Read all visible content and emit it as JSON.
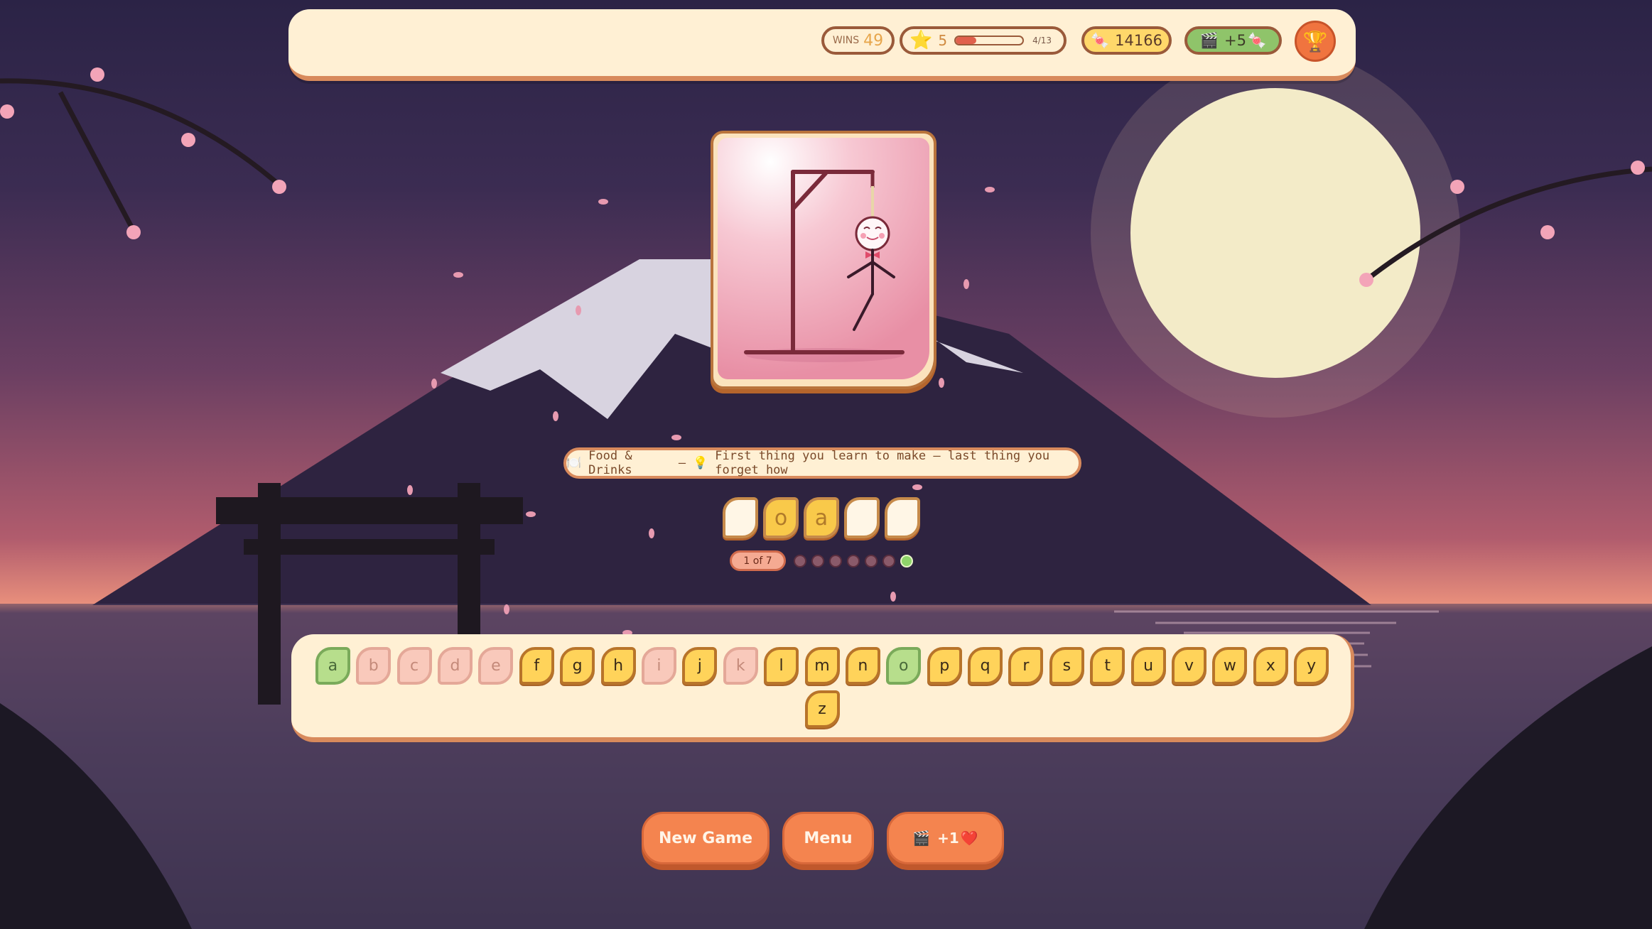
{
  "hud": {
    "wins_label": "WINS",
    "wins_value": "49",
    "level": "5",
    "level_progress": 0.31,
    "level_progress_text": "4/13",
    "candy_count": "14166",
    "bonus_text": "+5",
    "star_icon": "⭐",
    "candy_icon": "🍬",
    "bonus_icon": "🎬",
    "trophy_icon": "🏆"
  },
  "hint": {
    "category_icon": "🍽️",
    "category": "Food & Drinks",
    "separator": "—",
    "bulb_icon": "💡",
    "clue": "First thing you learn to make — last thing you forget how"
  },
  "word": {
    "slots": [
      "",
      "o",
      "a",
      "",
      ""
    ]
  },
  "round": {
    "label": "1 of 7",
    "dots": 7,
    "active_index": 6
  },
  "keyboard": {
    "keys": [
      {
        "letter": "a",
        "state": "correct"
      },
      {
        "letter": "b",
        "state": "wrong"
      },
      {
        "letter": "c",
        "state": "wrong"
      },
      {
        "letter": "d",
        "state": "wrong"
      },
      {
        "letter": "e",
        "state": "wrong"
      },
      {
        "letter": "f",
        "state": "unused"
      },
      {
        "letter": "g",
        "state": "unused"
      },
      {
        "letter": "h",
        "state": "unused"
      },
      {
        "letter": "i",
        "state": "wrong"
      },
      {
        "letter": "j",
        "state": "unused"
      },
      {
        "letter": "k",
        "state": "wrong"
      },
      {
        "letter": "l",
        "state": "unused"
      },
      {
        "letter": "m",
        "state": "unused"
      },
      {
        "letter": "n",
        "state": "unused"
      },
      {
        "letter": "o",
        "state": "correct"
      },
      {
        "letter": "p",
        "state": "unused"
      },
      {
        "letter": "q",
        "state": "unused"
      },
      {
        "letter": "r",
        "state": "unused"
      },
      {
        "letter": "s",
        "state": "unused"
      },
      {
        "letter": "t",
        "state": "unused"
      },
      {
        "letter": "u",
        "state": "unused"
      },
      {
        "letter": "v",
        "state": "unused"
      },
      {
        "letter": "w",
        "state": "unused"
      },
      {
        "letter": "x",
        "state": "unused"
      },
      {
        "letter": "y",
        "state": "unused"
      },
      {
        "letter": "z",
        "state": "unused"
      }
    ]
  },
  "buttons": {
    "new_game": "New Game",
    "menu": "Menu",
    "ad_icon": "🎬",
    "ad_reward": "+1",
    "heart_icon": "❤️"
  },
  "colors": {
    "accent": "#f4844f",
    "panel": "#fff0d4",
    "correct": "#b7de8c",
    "wrong": "#f9c9bb",
    "key": "#ffd35a"
  }
}
